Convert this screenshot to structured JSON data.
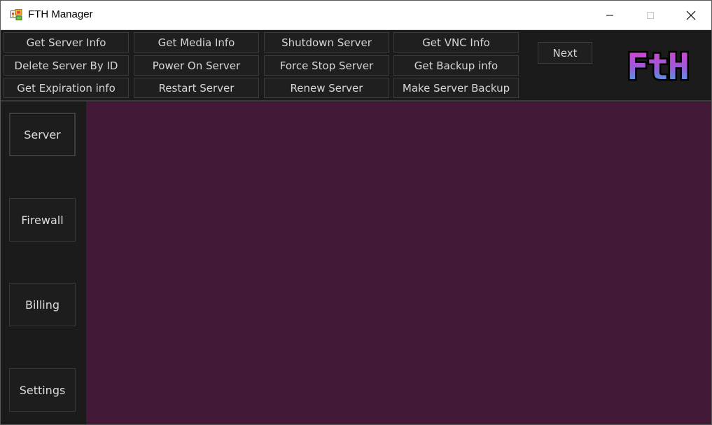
{
  "window": {
    "title": "FTH Manager",
    "icon": "app-window-icon",
    "controls": {
      "minimize": "minimize-icon",
      "maximize": "maximize-icon",
      "close": "close-icon"
    }
  },
  "toolbar": {
    "column1": [
      "Get Server Info",
      "Delete Server By ID",
      "Get Expiration info"
    ],
    "column2": [
      "Get Media Info",
      "Power On Server",
      "Restart Server"
    ],
    "column3": [
      "Shutdown Server",
      "Force Stop Server",
      "Renew Server"
    ],
    "column4": [
      "Get VNC Info",
      "Get Backup info",
      "Make Server Backup"
    ],
    "next_label": "Next"
  },
  "logo": {
    "text": "FtH",
    "colors": {
      "top": "#e33fd0",
      "bottom": "#2fb8e8",
      "outline": "#000000"
    }
  },
  "sidebar": {
    "items": [
      {
        "label": "Server",
        "active": true
      },
      {
        "label": "Firewall",
        "active": false
      },
      {
        "label": "Billing",
        "active": false
      },
      {
        "label": "Settings",
        "active": false
      }
    ]
  },
  "theme": {
    "background": "#1b1b1b",
    "panel": "#421a37",
    "button_text": "#d6d6d6"
  }
}
